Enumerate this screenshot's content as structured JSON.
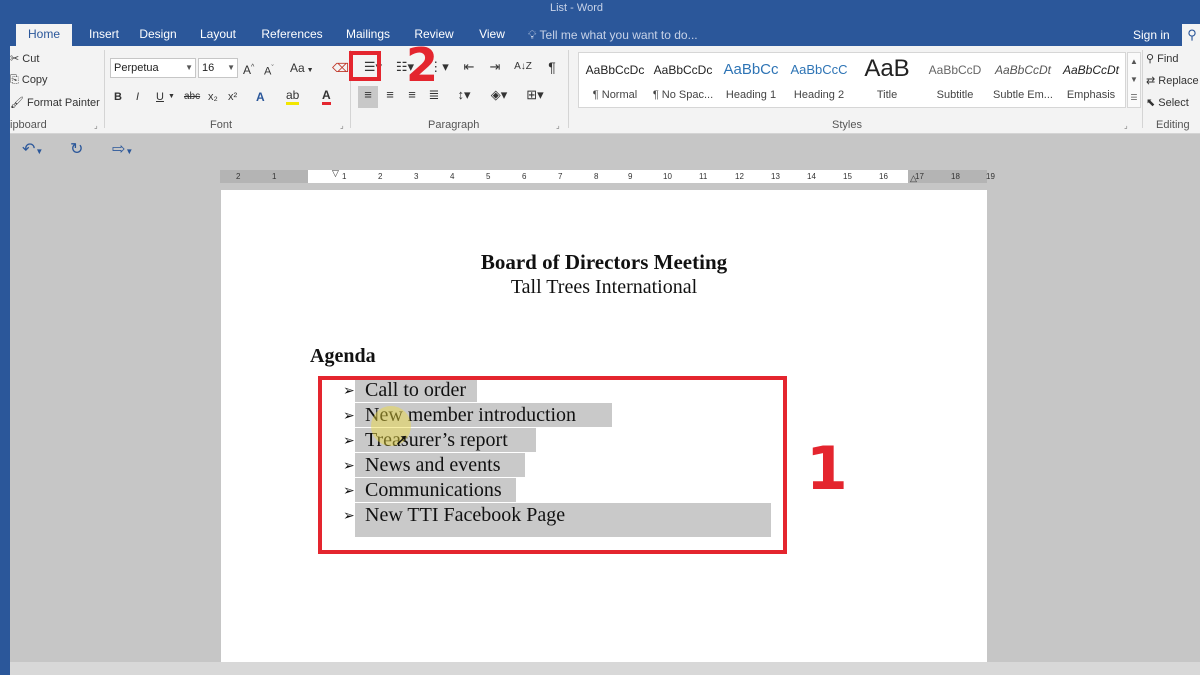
{
  "window": {
    "title": "List - Word"
  },
  "tabs": [
    "Home",
    "Insert",
    "Design",
    "Layout",
    "References",
    "Mailings",
    "Review",
    "View"
  ],
  "tell_me": "Tell me what you want to do...",
  "sign_in": "Sign in",
  "clipboard": {
    "cut": "Cut",
    "copy": "Copy",
    "format_painter": "Format Painter",
    "group_label": "ipboard"
  },
  "font": {
    "name": "Perpetua",
    "size": "16",
    "grow": "A",
    "shrink": "A",
    "change_case": "Aa",
    "bold": "B",
    "italic": "I",
    "underline": "U",
    "strike": "abc",
    "subscript": "x₂",
    "superscript": "x²",
    "group_label": "Font"
  },
  "paragraph": {
    "group_label": "Paragraph",
    "sort": "A↓Z",
    "pilcrow": "¶"
  },
  "styles": {
    "group_label": "Styles",
    "items": [
      {
        "sample": "AaBbCcDc",
        "name": "¶ Normal"
      },
      {
        "sample": "AaBbCcDc",
        "name": "¶ No Spac..."
      },
      {
        "sample": "AaBbCc",
        "name": "Heading 1"
      },
      {
        "sample": "AaBbCcC",
        "name": "Heading 2"
      },
      {
        "sample": "AaB",
        "name": "Title"
      },
      {
        "sample": "AaBbCcD",
        "name": "Subtitle"
      },
      {
        "sample": "AaBbCcDt",
        "name": "Subtle Em..."
      },
      {
        "sample": "AaBbCcDt",
        "name": "Emphasis"
      }
    ]
  },
  "editing": {
    "find": "Find",
    "replace": "Replace",
    "select": "Select",
    "group_label": "Editing"
  },
  "ruler": {
    "numbers": [
      "2",
      "1",
      "1",
      "2",
      "3",
      "4",
      "5",
      "6",
      "7",
      "8",
      "9",
      "10",
      "11",
      "12",
      "13",
      "14",
      "15",
      "16",
      "17",
      "18",
      "19"
    ]
  },
  "document": {
    "title": "Board of Directors Meeting",
    "subtitle": "Tall Trees International",
    "agenda_heading": "Agenda",
    "bullet_glyph": "➢",
    "items": [
      "Call to order",
      "New member introduction",
      "Treasurer’s report",
      "News and events",
      "Communications",
      "New TTI Facebook Page"
    ]
  },
  "annotations": {
    "label_1": "1",
    "label_2": "2"
  },
  "colors": {
    "accent": "#2b579a",
    "annotation_red": "#e4252e",
    "selection": "#c9c9c9"
  }
}
